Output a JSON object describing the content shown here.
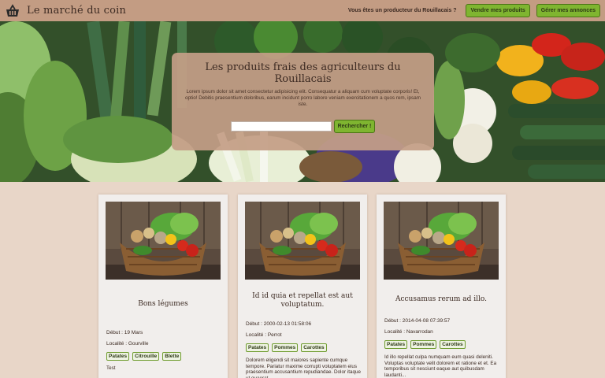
{
  "header": {
    "brand": "Le marché du coin",
    "producer_question": "Vous êtes un producteur du Rouillacais ?",
    "sell_button": "Vendre mes produits",
    "manage_button": "Gérer mes annonces"
  },
  "hero": {
    "title": "Les produits frais des agriculteurs du Rouillacais",
    "text": "Lorem ipsum dolor sit amet consectetur adipisicing elit. Consequatur a aliquam cum voluptate corporis! Et, optio! Debitis praesentium doloribus, earum incidunt porro labore veniam exercitationem a quos rem, ipsam iste.",
    "search_placeholder": "",
    "search_button": "Rechercher !"
  },
  "cards": [
    {
      "title": "Bons légumes",
      "debut": "Début : 19 Mars",
      "localite": "Localité : Gourville",
      "tags": [
        "Patates",
        "Citrouille",
        "Blette"
      ],
      "description": "Test"
    },
    {
      "title": "Id id quia et repellat est aut voluptatum.",
      "debut": "Début : 2000-02-13 01:58:06",
      "localite": "Localité : Perrot",
      "tags": [
        "Patates",
        "Pommes",
        "Carottes"
      ],
      "description": "Dolorem eligendi sit maiores sapiente cumque tempore. Pariatur maxime corrupti voluptatem eius praesentium accusantium repudiandae. Dolor itaque ut quaerat."
    },
    {
      "title": "Accusamus rerum ad illo.",
      "debut": "Début : 2014-04-08 07:39:57",
      "localite": "Localité : Navarrodan",
      "tags": [
        "Patates",
        "Pommes",
        "Carottes"
      ],
      "description": "Id illo repellat culpa numquam eum quasi deleniti. Voluptas voluptate velit dolorem et ratione et et. Ea temporibus sit nesciunt eaque aut quibusdam laudanti..."
    }
  ],
  "colors": {
    "navbar": "#c39c83",
    "page_background": "#e8d6c8",
    "accent_green": "#7fb530",
    "text_dark": "#3c2a22"
  },
  "icons": [
    "basket-icon"
  ]
}
